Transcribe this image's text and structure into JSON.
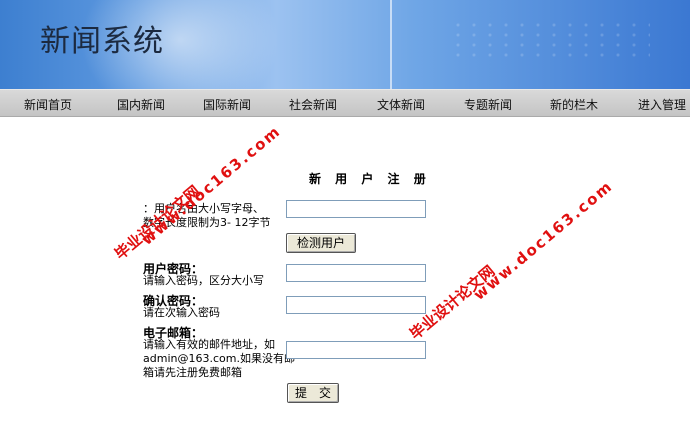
{
  "site": {
    "title": "新闻系统"
  },
  "nav": [
    {
      "label": "新闻首页"
    },
    {
      "label": "国内新闻"
    },
    {
      "label": "国际新闻"
    },
    {
      "label": "社会新闻"
    },
    {
      "label": "文体新闻"
    },
    {
      "label": "专题新闻"
    },
    {
      "label": "新的栏木"
    },
    {
      "label": "进入管理"
    }
  ],
  "form": {
    "title": "新 用 户 注 册",
    "username": {
      "hint1": "：用户名由大小写字母、",
      "hint2": "数字长度限制为3- 12字节",
      "value": ""
    },
    "check_button": "检测用户",
    "password": {
      "label": "用户密码：",
      "hint": "请输入密码，区分大小写",
      "value": ""
    },
    "confirm": {
      "label": "确认密码：",
      "hint": "请在次输入密码",
      "value": ""
    },
    "email": {
      "label": "电子邮箱：",
      "hint1": "请输入有效的邮件地址，如",
      "hint2": "admin@163.com.如果没有邮",
      "hint3": "箱请先注册免费邮箱",
      "value": ""
    },
    "submit_button": "提　交"
  },
  "watermark": {
    "url": "www.doc163.com",
    "text": "毕业设计论文网"
  }
}
